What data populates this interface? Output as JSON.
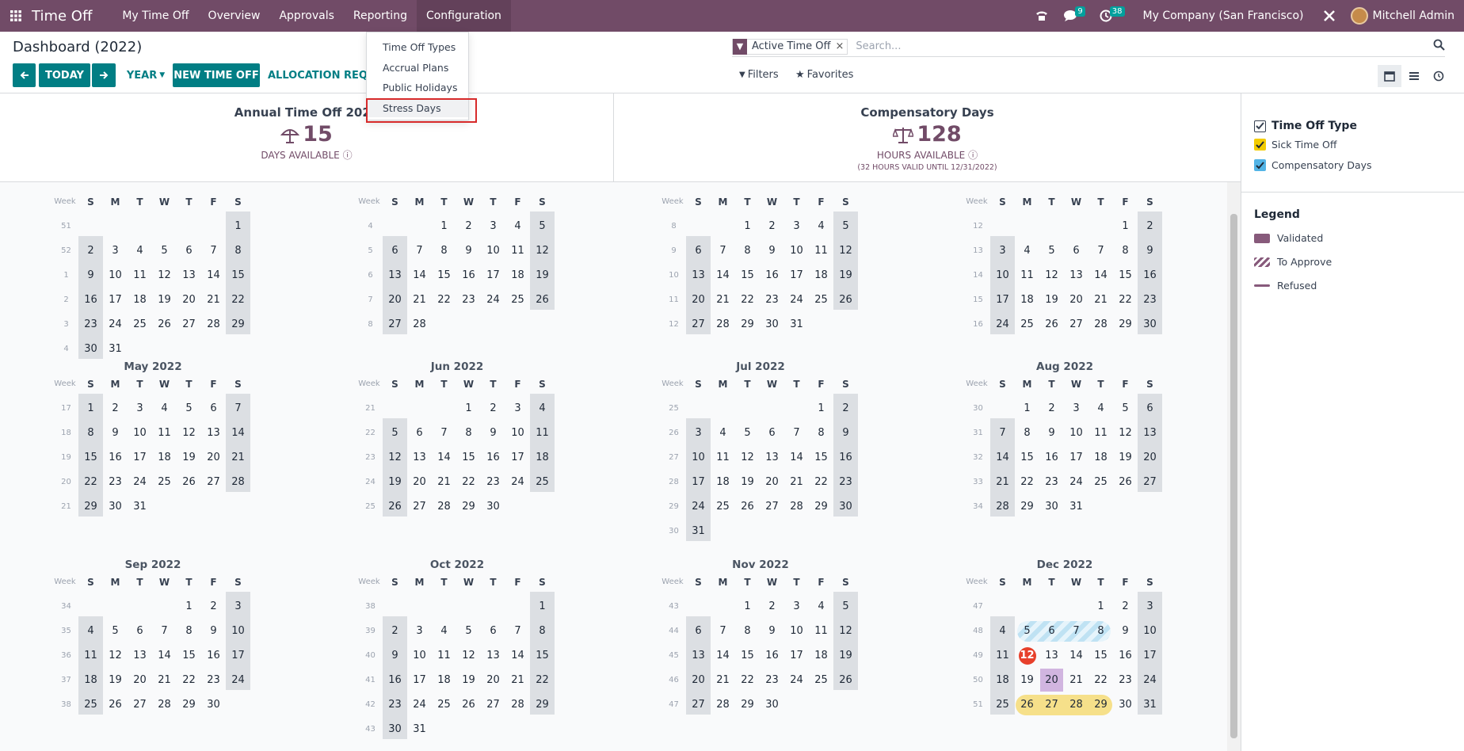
{
  "navbar": {
    "brand": "Time Off",
    "menus": [
      "My Time Off",
      "Overview",
      "Approvals",
      "Reporting",
      "Configuration"
    ],
    "chat_badge": "9",
    "activity_badge": "38",
    "company": "My Company (San Francisco)",
    "user": "Mitchell Admin"
  },
  "config_menu": {
    "items": [
      "Time Off Types",
      "Accrual Plans",
      "Public Holidays",
      "Stress Days"
    ]
  },
  "control": {
    "title": "Dashboard (2022)",
    "today": "TODAY",
    "year": "YEAR",
    "new_time_off": "NEW TIME OFF",
    "allocation_request": "ALLOCATION REQUEST",
    "search_facet": "Active Time Off",
    "search_placeholder": "Search...",
    "filters": "Filters",
    "favorites": "Favorites"
  },
  "summary": [
    {
      "title": "Annual Time Off 2022",
      "value": "15",
      "sub": "DAYS AVAILABLE",
      "note": ""
    },
    {
      "title": "Compensatory Days",
      "value": "128",
      "sub": "HOURS AVAILABLE",
      "note": "(32 HOURS VALID UNTIL 12/31/2022)"
    }
  ],
  "calendar": {
    "week_label": "Week",
    "day_headers": [
      "S",
      "M",
      "T",
      "W",
      "T",
      "F",
      "S"
    ],
    "months": [
      {
        "title": "",
        "start": 6,
        "days": 31,
        "weeks": [
          51,
          52,
          1,
          2,
          3,
          4
        ]
      },
      {
        "title": "",
        "start": 2,
        "days": 28,
        "weeks": [
          4,
          5,
          6,
          7,
          8
        ]
      },
      {
        "title": "",
        "start": 2,
        "days": 31,
        "weeks": [
          8,
          9,
          10,
          11,
          12
        ]
      },
      {
        "title": "",
        "start": 5,
        "days": 30,
        "weeks": [
          12,
          13,
          14,
          15,
          16
        ]
      },
      {
        "title": "May 2022",
        "start": 0,
        "days": 31,
        "weeks": [
          17,
          18,
          19,
          20,
          21
        ]
      },
      {
        "title": "Jun 2022",
        "start": 3,
        "days": 30,
        "weeks": [
          21,
          22,
          23,
          24,
          25
        ]
      },
      {
        "title": "Jul 2022",
        "start": 5,
        "days": 31,
        "weeks": [
          25,
          26,
          27,
          28,
          29,
          30
        ]
      },
      {
        "title": "Aug 2022",
        "start": 1,
        "days": 31,
        "weeks": [
          30,
          31,
          32,
          33,
          34
        ]
      },
      {
        "title": "Sep 2022",
        "start": 4,
        "days": 30,
        "weeks": [
          34,
          35,
          36,
          37,
          38
        ]
      },
      {
        "title": "Oct 2022",
        "start": 6,
        "days": 31,
        "weeks": [
          38,
          39,
          40,
          41,
          42,
          43
        ]
      },
      {
        "title": "Nov 2022",
        "start": 2,
        "days": 30,
        "weeks": [
          43,
          44,
          45,
          46,
          47
        ]
      },
      {
        "title": "Dec 2022",
        "start": 4,
        "days": 31,
        "weeks": [
          47,
          48,
          49,
          50,
          51
        ]
      }
    ],
    "today": "Dec 12",
    "to_approve_range": "Dec 5 - Dec 8",
    "highlighted_day": "Dec 20",
    "leave_range": "Dec 26 - Dec 29"
  },
  "sidepanel": {
    "filter_title": "Time Off Type",
    "types": [
      {
        "label": "Sick Time Off",
        "color": "#f3cc00"
      },
      {
        "label": "Compensatory Days",
        "color": "#53b4e6"
      }
    ],
    "legend_title": "Legend",
    "legend": [
      {
        "label": "Validated",
        "style": "solid"
      },
      {
        "label": "To Approve",
        "style": "hatched"
      },
      {
        "label": "Refused",
        "style": "line"
      }
    ]
  },
  "colors": {
    "brand": "#714b67",
    "action": "#017e84",
    "weekend": "#dcdfe3",
    "today": "#e7402b"
  }
}
